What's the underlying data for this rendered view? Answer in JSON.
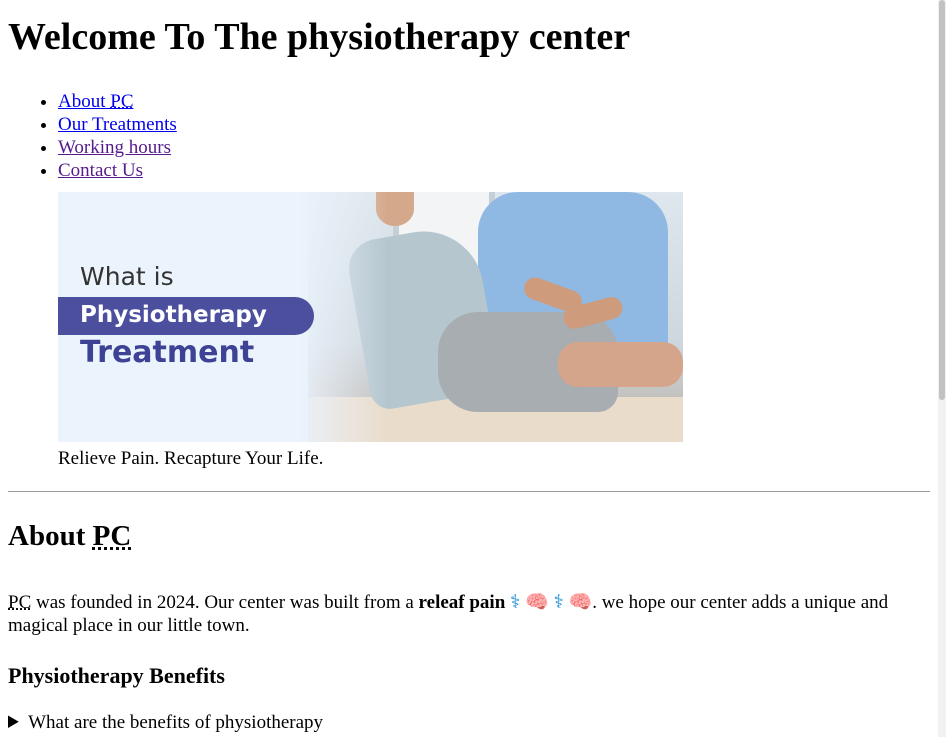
{
  "header": {
    "title": "Welcome To The physiotherapy center"
  },
  "nav": {
    "items": [
      {
        "label": "About PC",
        "label_prefix": "About ",
        "label_abbr": "PC"
      },
      {
        "label": "Our Treatments"
      },
      {
        "label": "Working hours"
      },
      {
        "label": "Contact Us"
      }
    ]
  },
  "banner": {
    "line1": "What is",
    "line2": "Physiotherapy",
    "line3": "Treatment",
    "caption": "Relieve Pain. Recapture Your Life."
  },
  "about": {
    "heading_prefix": "About ",
    "heading_abbr": "PC",
    "abbr": "PC",
    "text1": " was founded in 2024. Our center was built from a ",
    "bold": "releaf pain",
    "emoji_staff": "⚕",
    "emoji_brain": "🧠",
    "text2": ". we hope our center adds a unique and magical place in our little town."
  },
  "benefits": {
    "heading": "Physiotherapy Benefits",
    "summary": "What are the benefits of physiotherapy"
  }
}
